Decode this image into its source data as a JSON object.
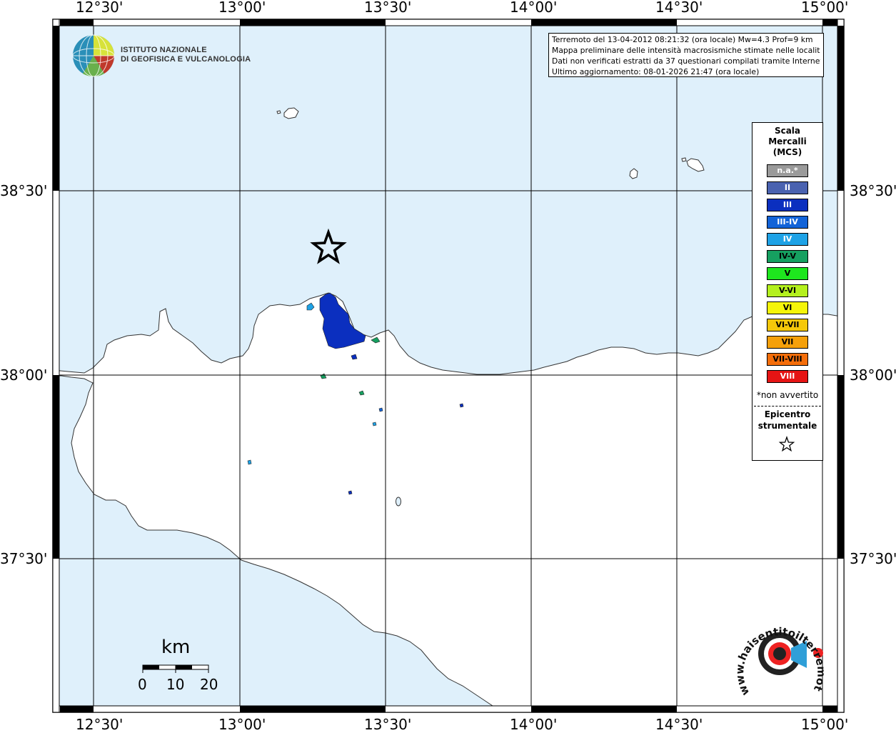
{
  "map": {
    "longitude_labels": [
      "12°30'",
      "13°00'",
      "13°30'",
      "14°00'",
      "14°30'",
      "15°00'"
    ],
    "latitude_labels": [
      "38°30'",
      "38°00'",
      "37°30'"
    ],
    "colors": {
      "sea": "#dff0fb",
      "land": "#ffffff",
      "intensity_III": "#0b2fbf",
      "intensity_IV": "#1ea2e6",
      "intensity_IV_V": "#16a060"
    }
  },
  "info_box": {
    "line1": "Terremoto del 13-04-2012 08:21:32 (ora locale) Mw=4.3 Prof=9 km",
    "line2": "Mappa preliminare delle intensità macrosismiche stimate nelle località",
    "line3": "Dati non verificati estratti da 37 questionari compilati tramite Internet.",
    "line4": "Ultimo aggiornamento: 08-01-2026 21:47 (ora locale)"
  },
  "legend": {
    "title_line1": "Scala",
    "title_line2": "Mercalli",
    "title_line3": "(MCS)",
    "items": [
      {
        "label": "n.a.*",
        "color": "#9a9a9a"
      },
      {
        "label": "II",
        "color": "#4a62b0"
      },
      {
        "label": "III",
        "color": "#0b2fbf"
      },
      {
        "label": "III-IV",
        "color": "#1263d8"
      },
      {
        "label": "IV",
        "color": "#1ea2e6"
      },
      {
        "label": "IV-V",
        "color": "#16a060"
      },
      {
        "label": "V",
        "color": "#1ee61e"
      },
      {
        "label": "V-VI",
        "color": "#b4f01e"
      },
      {
        "label": "VI",
        "color": "#f5f50a"
      },
      {
        "label": "VI-VII",
        "color": "#f5c80a"
      },
      {
        "label": "VII",
        "color": "#f5a00a"
      },
      {
        "label": "VII-VIII",
        "color": "#f56e0a"
      },
      {
        "label": "VIII",
        "color": "#e61414"
      }
    ],
    "note": "*non avvertito",
    "epicenter_line1": "Epicentro",
    "epicenter_line2": "strumentale"
  },
  "logo": {
    "ingv_line1": "ISTITUTO NAZIONALE",
    "ingv_line2": "DI GEOFISICA E VULCANOLOGIA",
    "hst_text": "www.haisentitoilterremoto.it"
  },
  "scale_bar": {
    "unit": "km",
    "labels": [
      "0",
      "10",
      "20"
    ]
  }
}
